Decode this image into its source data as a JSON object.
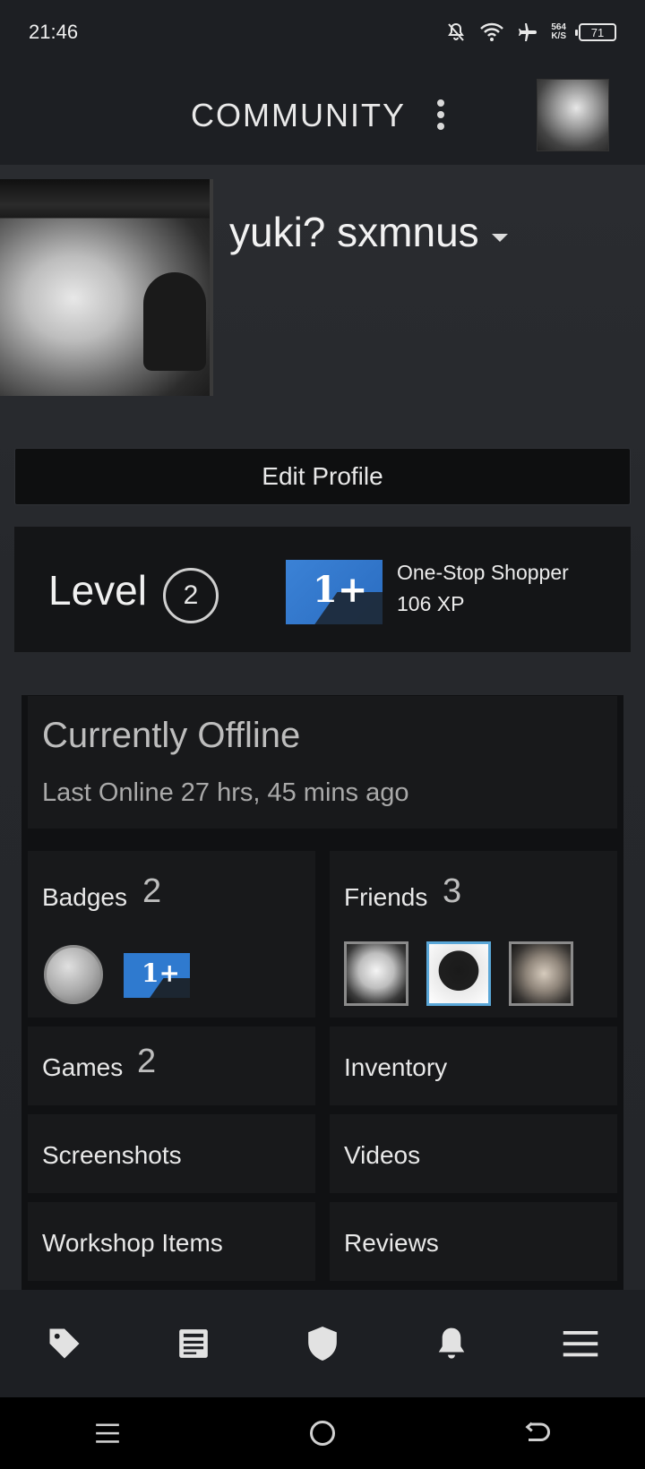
{
  "status_bar": {
    "time": "21:46",
    "net_speed_top": "564",
    "net_speed_bottom": "K/S",
    "battery": "71"
  },
  "header": {
    "title": "COMMUNITY"
  },
  "profile": {
    "name": "yuki? sxmnus",
    "edit_label": "Edit Profile",
    "level_label": "Level",
    "level_value": "2",
    "featured_badge_name": "One-Stop Shopper",
    "featured_badge_xp": "106 XP",
    "featured_badge_mark": "1+"
  },
  "status": {
    "title": "Currently Offline",
    "last_online": "Last Online 27 hrs, 45 mins ago"
  },
  "tiles": {
    "badges": {
      "label": "Badges",
      "count": "2",
      "badge2_mark": "1+"
    },
    "friends": {
      "label": "Friends",
      "count": "3"
    },
    "games": {
      "label": "Games",
      "count": "2"
    },
    "inventory": {
      "label": "Inventory"
    },
    "screenshots": {
      "label": "Screenshots"
    },
    "videos": {
      "label": "Videos"
    },
    "workshop": {
      "label": "Workshop Items"
    },
    "reviews": {
      "label": "Reviews"
    }
  },
  "bottom_nav": [
    "tag-icon",
    "news-icon",
    "shield-icon",
    "bell-icon",
    "menu-icon"
  ],
  "colors": {
    "background": "#1b1d21",
    "card": "#18191b",
    "badge_blue": "#2f7acf",
    "friend_highlight": "#5aa7d8"
  }
}
